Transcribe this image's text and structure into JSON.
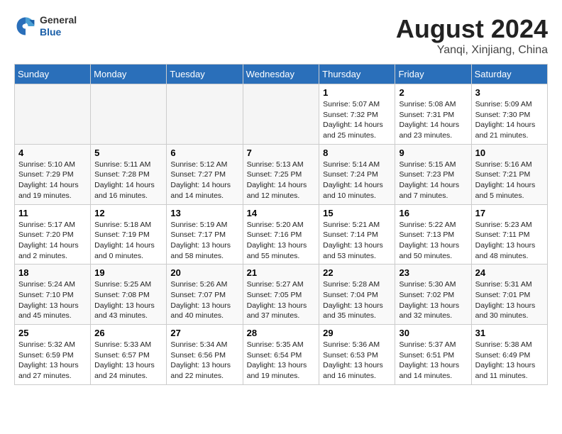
{
  "header": {
    "logo_general": "General",
    "logo_blue": "Blue",
    "month_title": "August 2024",
    "location": "Yanqi, Xinjiang, China"
  },
  "weekdays": [
    "Sunday",
    "Monday",
    "Tuesday",
    "Wednesday",
    "Thursday",
    "Friday",
    "Saturday"
  ],
  "weeks": [
    [
      {
        "day": "",
        "info": ""
      },
      {
        "day": "",
        "info": ""
      },
      {
        "day": "",
        "info": ""
      },
      {
        "day": "",
        "info": ""
      },
      {
        "day": "1",
        "info": "Sunrise: 5:07 AM\nSunset: 7:32 PM\nDaylight: 14 hours and 25 minutes."
      },
      {
        "day": "2",
        "info": "Sunrise: 5:08 AM\nSunset: 7:31 PM\nDaylight: 14 hours and 23 minutes."
      },
      {
        "day": "3",
        "info": "Sunrise: 5:09 AM\nSunset: 7:30 PM\nDaylight: 14 hours and 21 minutes."
      }
    ],
    [
      {
        "day": "4",
        "info": "Sunrise: 5:10 AM\nSunset: 7:29 PM\nDaylight: 14 hours and 19 minutes."
      },
      {
        "day": "5",
        "info": "Sunrise: 5:11 AM\nSunset: 7:28 PM\nDaylight: 14 hours and 16 minutes."
      },
      {
        "day": "6",
        "info": "Sunrise: 5:12 AM\nSunset: 7:27 PM\nDaylight: 14 hours and 14 minutes."
      },
      {
        "day": "7",
        "info": "Sunrise: 5:13 AM\nSunset: 7:25 PM\nDaylight: 14 hours and 12 minutes."
      },
      {
        "day": "8",
        "info": "Sunrise: 5:14 AM\nSunset: 7:24 PM\nDaylight: 14 hours and 10 minutes."
      },
      {
        "day": "9",
        "info": "Sunrise: 5:15 AM\nSunset: 7:23 PM\nDaylight: 14 hours and 7 minutes."
      },
      {
        "day": "10",
        "info": "Sunrise: 5:16 AM\nSunset: 7:21 PM\nDaylight: 14 hours and 5 minutes."
      }
    ],
    [
      {
        "day": "11",
        "info": "Sunrise: 5:17 AM\nSunset: 7:20 PM\nDaylight: 14 hours and 2 minutes."
      },
      {
        "day": "12",
        "info": "Sunrise: 5:18 AM\nSunset: 7:19 PM\nDaylight: 14 hours and 0 minutes."
      },
      {
        "day": "13",
        "info": "Sunrise: 5:19 AM\nSunset: 7:17 PM\nDaylight: 13 hours and 58 minutes."
      },
      {
        "day": "14",
        "info": "Sunrise: 5:20 AM\nSunset: 7:16 PM\nDaylight: 13 hours and 55 minutes."
      },
      {
        "day": "15",
        "info": "Sunrise: 5:21 AM\nSunset: 7:14 PM\nDaylight: 13 hours and 53 minutes."
      },
      {
        "day": "16",
        "info": "Sunrise: 5:22 AM\nSunset: 7:13 PM\nDaylight: 13 hours and 50 minutes."
      },
      {
        "day": "17",
        "info": "Sunrise: 5:23 AM\nSunset: 7:11 PM\nDaylight: 13 hours and 48 minutes."
      }
    ],
    [
      {
        "day": "18",
        "info": "Sunrise: 5:24 AM\nSunset: 7:10 PM\nDaylight: 13 hours and 45 minutes."
      },
      {
        "day": "19",
        "info": "Sunrise: 5:25 AM\nSunset: 7:08 PM\nDaylight: 13 hours and 43 minutes."
      },
      {
        "day": "20",
        "info": "Sunrise: 5:26 AM\nSunset: 7:07 PM\nDaylight: 13 hours and 40 minutes."
      },
      {
        "day": "21",
        "info": "Sunrise: 5:27 AM\nSunset: 7:05 PM\nDaylight: 13 hours and 37 minutes."
      },
      {
        "day": "22",
        "info": "Sunrise: 5:28 AM\nSunset: 7:04 PM\nDaylight: 13 hours and 35 minutes."
      },
      {
        "day": "23",
        "info": "Sunrise: 5:30 AM\nSunset: 7:02 PM\nDaylight: 13 hours and 32 minutes."
      },
      {
        "day": "24",
        "info": "Sunrise: 5:31 AM\nSunset: 7:01 PM\nDaylight: 13 hours and 30 minutes."
      }
    ],
    [
      {
        "day": "25",
        "info": "Sunrise: 5:32 AM\nSunset: 6:59 PM\nDaylight: 13 hours and 27 minutes."
      },
      {
        "day": "26",
        "info": "Sunrise: 5:33 AM\nSunset: 6:57 PM\nDaylight: 13 hours and 24 minutes."
      },
      {
        "day": "27",
        "info": "Sunrise: 5:34 AM\nSunset: 6:56 PM\nDaylight: 13 hours and 22 minutes."
      },
      {
        "day": "28",
        "info": "Sunrise: 5:35 AM\nSunset: 6:54 PM\nDaylight: 13 hours and 19 minutes."
      },
      {
        "day": "29",
        "info": "Sunrise: 5:36 AM\nSunset: 6:53 PM\nDaylight: 13 hours and 16 minutes."
      },
      {
        "day": "30",
        "info": "Sunrise: 5:37 AM\nSunset: 6:51 PM\nDaylight: 13 hours and 14 minutes."
      },
      {
        "day": "31",
        "info": "Sunrise: 5:38 AM\nSunset: 6:49 PM\nDaylight: 13 hours and 11 minutes."
      }
    ]
  ]
}
